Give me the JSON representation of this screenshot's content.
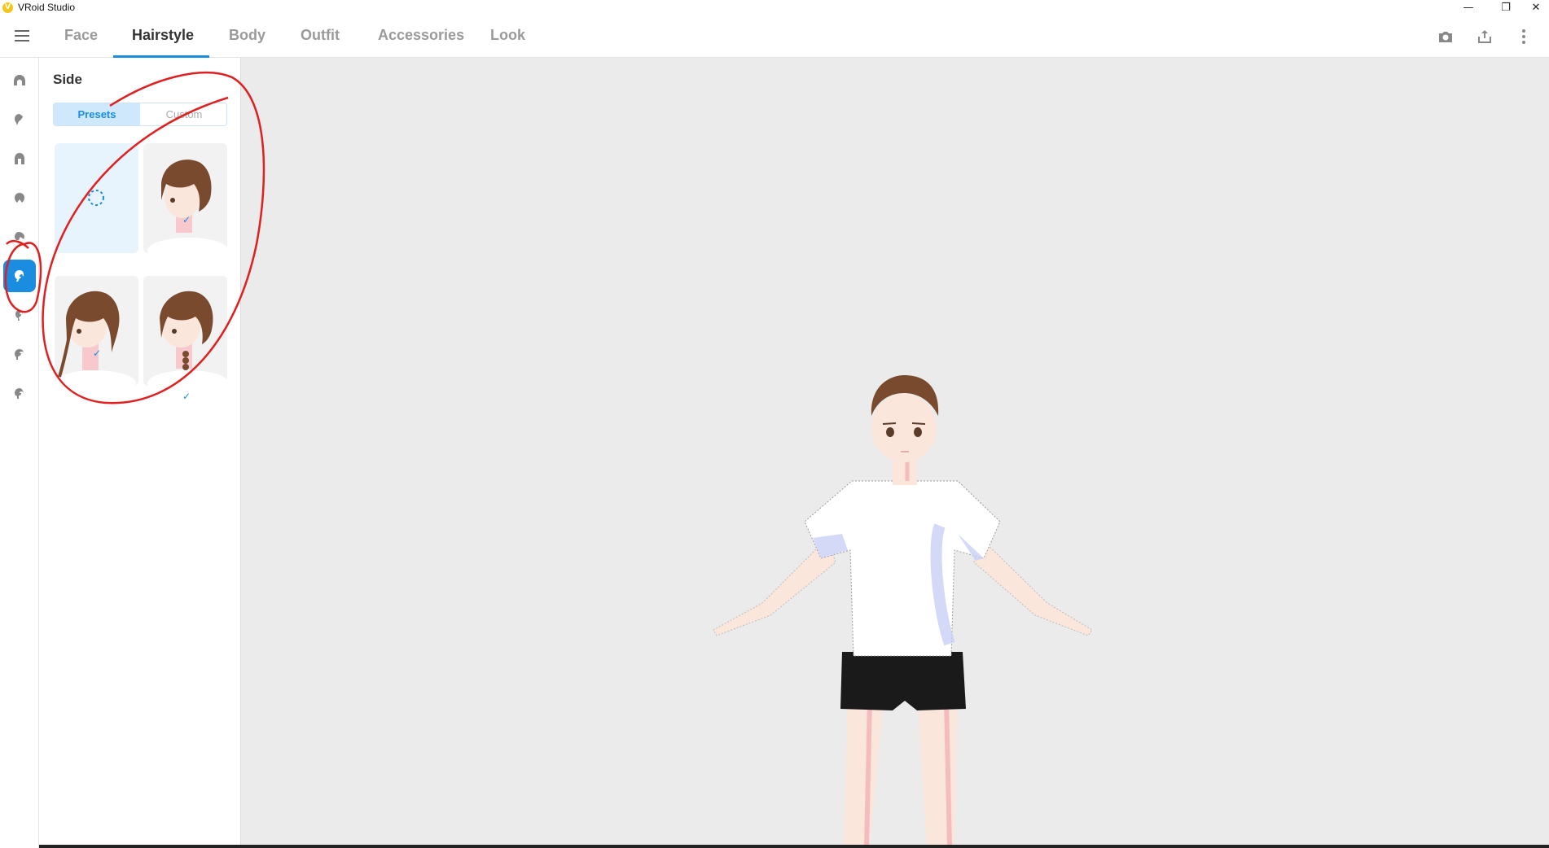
{
  "window": {
    "title": "VRoid Studio",
    "controls": {
      "minimize": "—",
      "restore": "❐",
      "close": "✕"
    }
  },
  "tabs": [
    {
      "label": "Face"
    },
    {
      "label": "Hairstyle"
    },
    {
      "label": "Body"
    },
    {
      "label": "Outfit"
    },
    {
      "label": "Accessories"
    },
    {
      "label": "Look"
    }
  ],
  "active_tab": "Hairstyle",
  "top_icons": [
    "camera-icon",
    "export-icon",
    "more-vert-icon"
  ],
  "rail": {
    "items": [
      "hair-front-icon",
      "hair-bangs-icon",
      "hair-back-icon",
      "hair-ahoge-icon",
      "hair-tail-icon",
      "hair-side-icon",
      "hair-extra-icon",
      "hair-bun-icon",
      "hair-other-icon"
    ],
    "active_index": 5
  },
  "panel": {
    "title": "Side",
    "segment": {
      "presets": "Presets",
      "custom": "Custom",
      "active": "Presets"
    },
    "presets": [
      {
        "kind": "none",
        "checked": false
      },
      {
        "kind": "short-bob",
        "checked": true
      },
      {
        "kind": "long-side-lock",
        "checked": true
      },
      {
        "kind": "braid",
        "checked": true
      }
    ],
    "check_glyph": "✓"
  },
  "colors": {
    "accent": "#1a8de0",
    "hair": "#7a4a2e",
    "skin": "#fbe6dc",
    "shirt": "#ffffff",
    "shorts": "#1a1a1a",
    "annotation": "#e02020",
    "viewport_bg": "#ebebeb"
  }
}
